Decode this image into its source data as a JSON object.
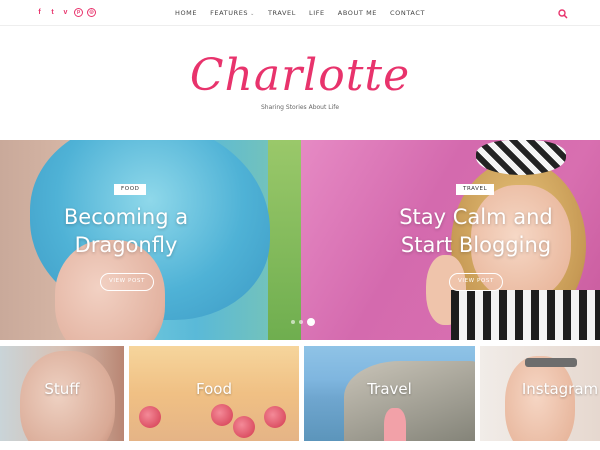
{
  "social": [
    {
      "icon": "facebook-icon",
      "glyph": "f"
    },
    {
      "icon": "twitter-icon",
      "glyph": "t"
    },
    {
      "icon": "vimeo-icon",
      "glyph": "v"
    },
    {
      "icon": "pinterest-icon",
      "glyph": "p"
    },
    {
      "icon": "instagram-icon",
      "glyph": "◎"
    }
  ],
  "nav": {
    "home": "HOME",
    "features": "FEATURES",
    "travel": "TRAVEL",
    "life": "LIFE",
    "about": "ABOUT ME",
    "contact": "CONTACT"
  },
  "header": {
    "title": "Charlotte",
    "tagline": "Sharing Stories About Life"
  },
  "slides": [
    {
      "category": "FOOD",
      "title_line1": "Becoming a",
      "title_line2": "Dragonfly",
      "button": "VIEW POST"
    },
    {
      "category": "TRAVEL",
      "title_line1": "Stay Calm and",
      "title_line2": "Start Blogging",
      "button": "VIEW POST"
    }
  ],
  "categories": [
    "Stuff",
    "Food",
    "Travel",
    "Instagram"
  ],
  "colors": {
    "accent": "#e8336c"
  }
}
